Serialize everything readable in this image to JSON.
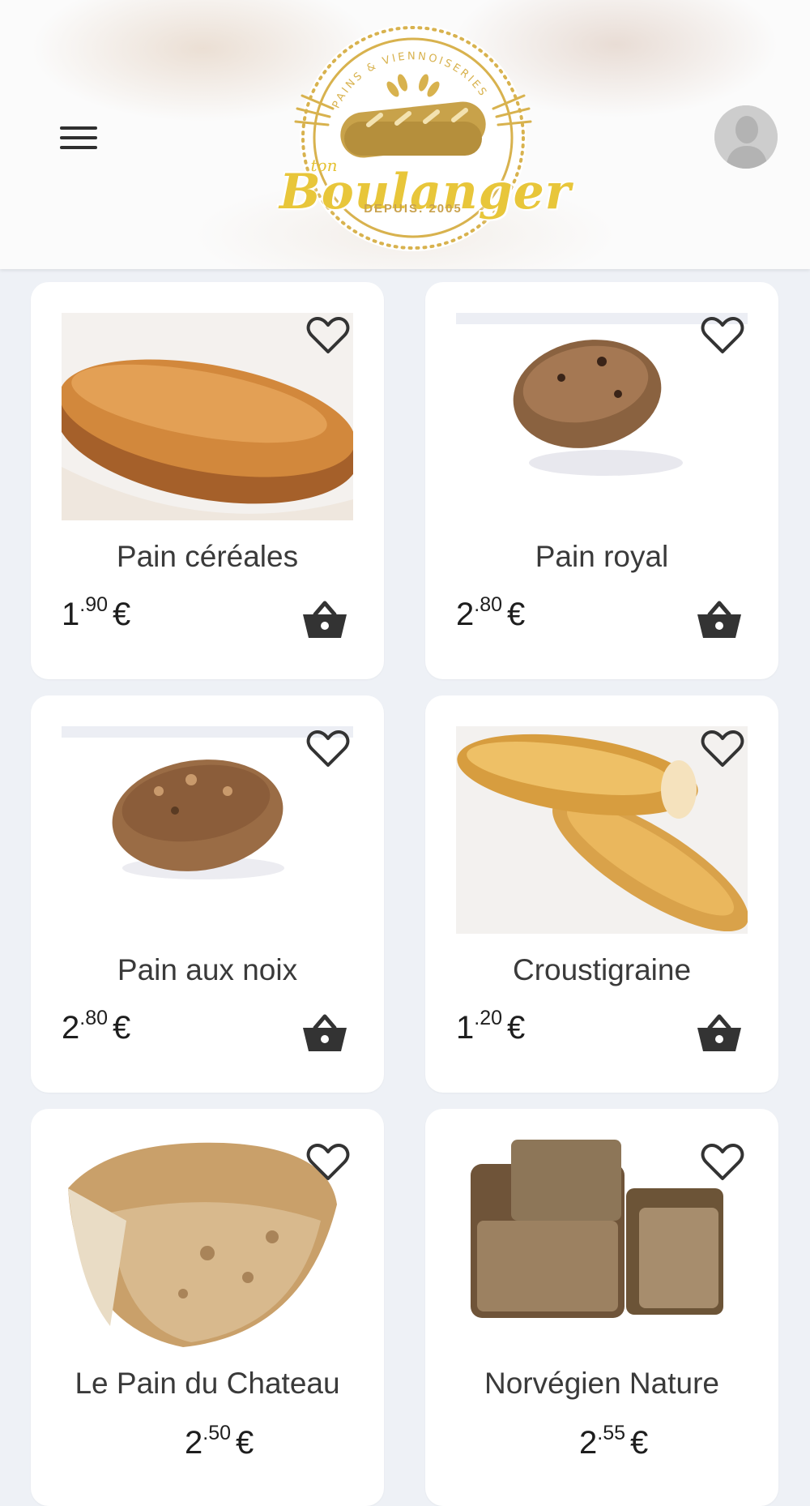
{
  "header": {
    "logo": {
      "arc_text": "PAINS & VIENNOISERIES",
      "small": "ton",
      "name": "Boulanger",
      "since": "DEPUIS. 2005"
    },
    "menu_icon": "hamburger-menu-icon",
    "avatar_icon": "user-avatar-icon"
  },
  "colors": {
    "background": "#eef1f6",
    "card": "#ffffff",
    "logo_gold": "#e8c63a",
    "icon_dark": "#333333"
  },
  "products": [
    {
      "name": "Pain céréales",
      "price_int": "1",
      "price_dec": ".90",
      "currency": "€"
    },
    {
      "name": "Pain royal",
      "price_int": "2",
      "price_dec": ".80",
      "currency": "€"
    },
    {
      "name": "Pain aux noix",
      "price_int": "2",
      "price_dec": ".80",
      "currency": "€"
    },
    {
      "name": "Croustigraine",
      "price_int": "1",
      "price_dec": ".20",
      "currency": "€"
    },
    {
      "name": "Le Pain du Chateau",
      "price_int": "2",
      "price_dec": ".50",
      "currency": "€"
    },
    {
      "name": "Norvégien Nature",
      "price_int": "2",
      "price_dec": ".55",
      "currency": "€"
    }
  ]
}
